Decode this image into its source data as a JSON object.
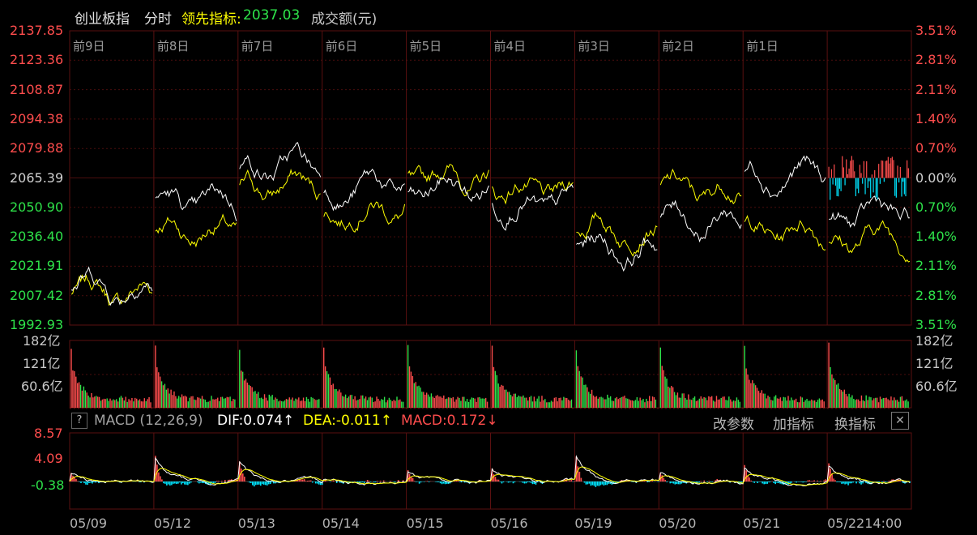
{
  "header": {
    "index_name": "创业板指",
    "period": "分时",
    "leading_label": "领先指标:",
    "leading_value": "2037.03",
    "volume_label": "成交额(元)"
  },
  "price_axis": {
    "left": [
      "2137.85",
      "2123.36",
      "2108.87",
      "2094.38",
      "2079.88",
      "2065.39",
      "2050.90",
      "2036.40",
      "2021.91",
      "2007.42",
      "1992.93"
    ],
    "right": [
      "3.51%",
      "2.81%",
      "2.11%",
      "1.40%",
      "0.70%",
      "0.00%",
      "0.70%",
      "1.40%",
      "2.11%",
      "2.81%",
      "3.51%"
    ]
  },
  "day_labels": [
    "前9日",
    "前8日",
    "前7日",
    "前6日",
    "前5日",
    "前4日",
    "前3日",
    "前2日",
    "前1日"
  ],
  "volume_axis": {
    "left": [
      "182亿",
      "121亿",
      "60.6亿"
    ],
    "right": [
      "182亿",
      "121亿",
      "60.6亿"
    ]
  },
  "macd_bar": {
    "help": "?",
    "name": "MACD (12,26,9)",
    "dif": "DIF:0.074↑",
    "dea": "DEA:-0.011↑",
    "macd": "MACD:0.172↓",
    "btn_params": "改参数",
    "btn_add": "加指标",
    "btn_switch": "换指标",
    "close": "✕"
  },
  "macd_axis": [
    "8.57",
    "4.09",
    "-0.38"
  ],
  "dates": [
    "05/09",
    "05/12",
    "05/13",
    "05/14",
    "05/15",
    "05/16",
    "05/19",
    "05/20",
    "05/21",
    "05/2214:00"
  ],
  "colors": {
    "up": "#ff4d4d",
    "down": "#2ee34a",
    "white_line": "#ffffff",
    "yellow_line": "#ffff00",
    "cyan": "#00e5ff",
    "grid": "#4a0d0d"
  },
  "chart_data": {
    "type": "line",
    "title": "创业板指 分时",
    "ylim": [
      1992.93,
      2137.85
    ],
    "reference_close": 2065.39,
    "categories": [
      "前9日",
      "前8日",
      "前7日",
      "前6日",
      "前5日",
      "前4日",
      "前3日",
      "前2日",
      "前1日",
      "05/22"
    ],
    "series": [
      {
        "name": "创业板指",
        "values": [
          2012,
          2052,
          2072,
          2062,
          2060,
          2052,
          2030,
          2045,
          2068,
          2048
        ]
      },
      {
        "name": "领先指标",
        "values": [
          2008,
          2040,
          2062,
          2052,
          2066,
          2058,
          2040,
          2058,
          2040,
          2037.03
        ]
      }
    ]
  }
}
